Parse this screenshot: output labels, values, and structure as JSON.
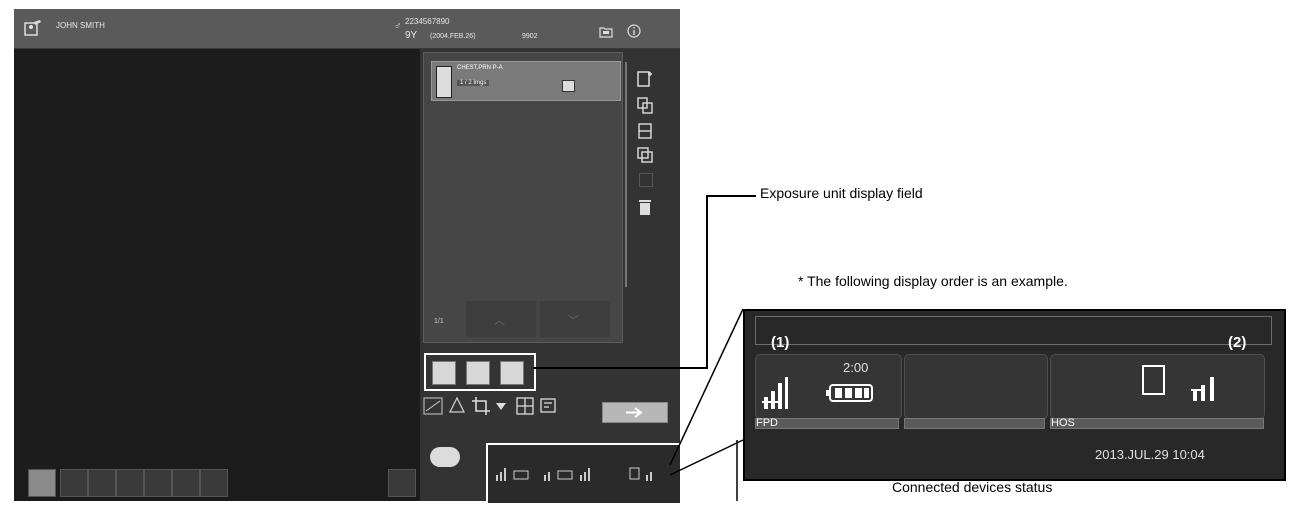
{
  "patient": {
    "name": "JOHN SMITH",
    "sex_age_icon": "patient-sex-icon",
    "id": "2234567890",
    "age": "9Y",
    "dob": "(2004.FEB.26)",
    "exam_code": "9902"
  },
  "study_list": {
    "item_name": "CHEST,PRN P-A",
    "item_count": "1 / 2 Imgs",
    "page_indicator": "1/1"
  },
  "callouts": {
    "exposure_unit": "Exposure unit display field",
    "order_note": "* The following display order is an example.",
    "connected_devices": "Connected devices status"
  },
  "devices_panel": {
    "label_1": "(1)",
    "label_2": "(2)",
    "battery_time": "2:00",
    "device_1_name": "FPD",
    "device_3_name": "HOS",
    "datetime": "2013.JUL.29 10:04"
  },
  "colors": {
    "app_background": "#4a4a4a",
    "viewer_background": "#1c1c1c",
    "panel_dark": "#282828",
    "highlight": "#ffffff"
  }
}
